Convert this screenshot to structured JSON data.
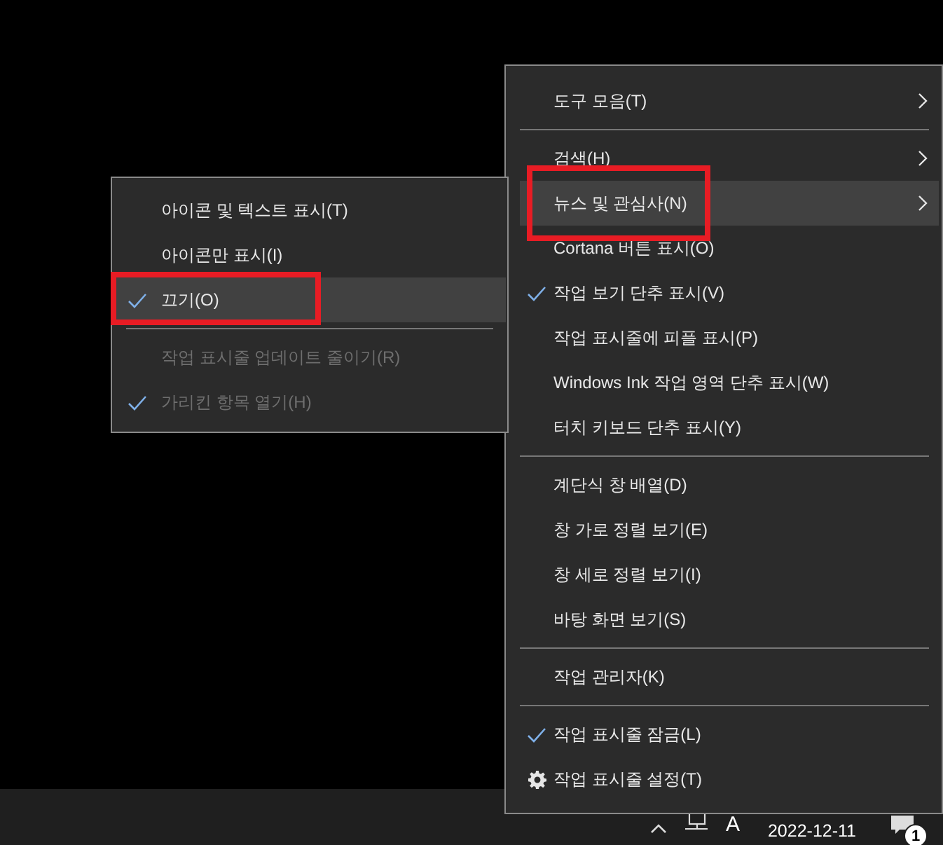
{
  "main_menu": {
    "items": [
      {
        "kind": "item",
        "label": "도구 모음(T)",
        "submenu": true,
        "checked": false,
        "selected": false,
        "outlined": false
      },
      {
        "kind": "separator"
      },
      {
        "kind": "item",
        "label": "검색(H)",
        "submenu": true,
        "checked": false,
        "selected": false,
        "outlined": false
      },
      {
        "kind": "item",
        "label": "뉴스 및 관심사(N)",
        "submenu": true,
        "checked": false,
        "selected": true,
        "outlined": true
      },
      {
        "kind": "item",
        "label": "Cortana 버튼 표시(O)",
        "submenu": false,
        "checked": false,
        "selected": false,
        "outlined": false
      },
      {
        "kind": "item",
        "label": "작업 보기 단추 표시(V)",
        "submenu": false,
        "checked": true,
        "selected": false,
        "outlined": false
      },
      {
        "kind": "item",
        "label": "작업 표시줄에 피플 표시(P)",
        "submenu": false,
        "checked": false,
        "selected": false,
        "outlined": false
      },
      {
        "kind": "item",
        "label": "Windows Ink 작업 영역 단추 표시(W)",
        "submenu": false,
        "checked": false,
        "selected": false,
        "outlined": false
      },
      {
        "kind": "item",
        "label": "터치 키보드 단추 표시(Y)",
        "submenu": false,
        "checked": false,
        "selected": false,
        "outlined": false
      },
      {
        "kind": "separator"
      },
      {
        "kind": "item",
        "label": "계단식 창 배열(D)",
        "submenu": false,
        "checked": false,
        "selected": false,
        "outlined": false
      },
      {
        "kind": "item",
        "label": "창 가로 정렬 보기(E)",
        "submenu": false,
        "checked": false,
        "selected": false,
        "outlined": false
      },
      {
        "kind": "item",
        "label": "창 세로 정렬 보기(I)",
        "submenu": false,
        "checked": false,
        "selected": false,
        "outlined": false
      },
      {
        "kind": "item",
        "label": "바탕 화면 보기(S)",
        "submenu": false,
        "checked": false,
        "selected": false,
        "outlined": false
      },
      {
        "kind": "separator"
      },
      {
        "kind": "item",
        "label": "작업 관리자(K)",
        "submenu": false,
        "checked": false,
        "selected": false,
        "outlined": false
      },
      {
        "kind": "separator"
      },
      {
        "kind": "item",
        "label": "작업 표시줄 잠금(L)",
        "submenu": false,
        "checked": true,
        "selected": false,
        "outlined": false
      },
      {
        "kind": "settings",
        "label": "작업 표시줄 설정(T)",
        "submenu": false,
        "checked": false,
        "selected": false,
        "outlined": false
      }
    ]
  },
  "submenu": {
    "items": [
      {
        "kind": "item",
        "label": "아이콘 및 텍스트 표시(T)",
        "checked": false,
        "selected": false,
        "outlined": false,
        "disabled": false
      },
      {
        "kind": "item",
        "label": "아이콘만 표시(I)",
        "checked": false,
        "selected": false,
        "outlined": false,
        "disabled": false
      },
      {
        "kind": "item",
        "label": "끄기(O)",
        "checked": true,
        "selected": true,
        "outlined": true,
        "disabled": false
      },
      {
        "kind": "separator"
      },
      {
        "kind": "item",
        "label": "작업 표시줄 업데이트 줄이기(R)",
        "checked": false,
        "selected": false,
        "outlined": false,
        "disabled": true
      },
      {
        "kind": "item",
        "label": "가리킨 항목 열기(H)",
        "checked": true,
        "selected": false,
        "outlined": false,
        "disabled": true
      }
    ]
  },
  "tray": {
    "ime": "A",
    "date": "2022-12-11",
    "notification_count": "1"
  }
}
